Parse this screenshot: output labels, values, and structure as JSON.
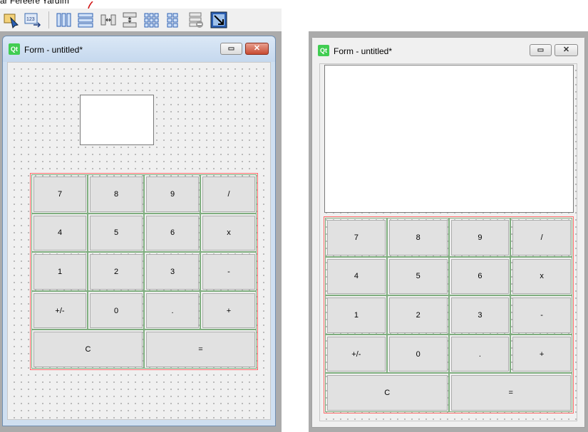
{
  "menu_fragment": "ar   Fereere   Yardım",
  "toolbar": {
    "icons": [
      "edit-widgets-icon",
      "tab-order-icon",
      "layout-horizontal-icon",
      "layout-vertical-icon",
      "layout-horizontal-splitter-icon",
      "layout-vertical-splitter-icon",
      "layout-grid-icon",
      "layout-form-icon",
      "break-layout-icon",
      "adjust-size-icon"
    ]
  },
  "windows": {
    "left": {
      "title": "Form - untitled*",
      "logo": "Qt"
    },
    "right": {
      "title": "Form - untitled*",
      "logo": "Qt"
    }
  },
  "window_controls": {
    "minimize": "▭",
    "close": "✕"
  },
  "calculator": {
    "rows": [
      [
        "7",
        "8",
        "9",
        "/"
      ],
      [
        "4",
        "5",
        "6",
        "x"
      ],
      [
        "1",
        "2",
        "3",
        "-"
      ],
      [
        "+/-",
        "0",
        ".",
        "+"
      ]
    ],
    "bottom": [
      "C",
      "="
    ]
  },
  "colors": {
    "layout_border": "#ff6a6a",
    "cell_border": "#7fae7f",
    "button_face": "#e1e1e1",
    "qt_green": "#41cd52"
  }
}
